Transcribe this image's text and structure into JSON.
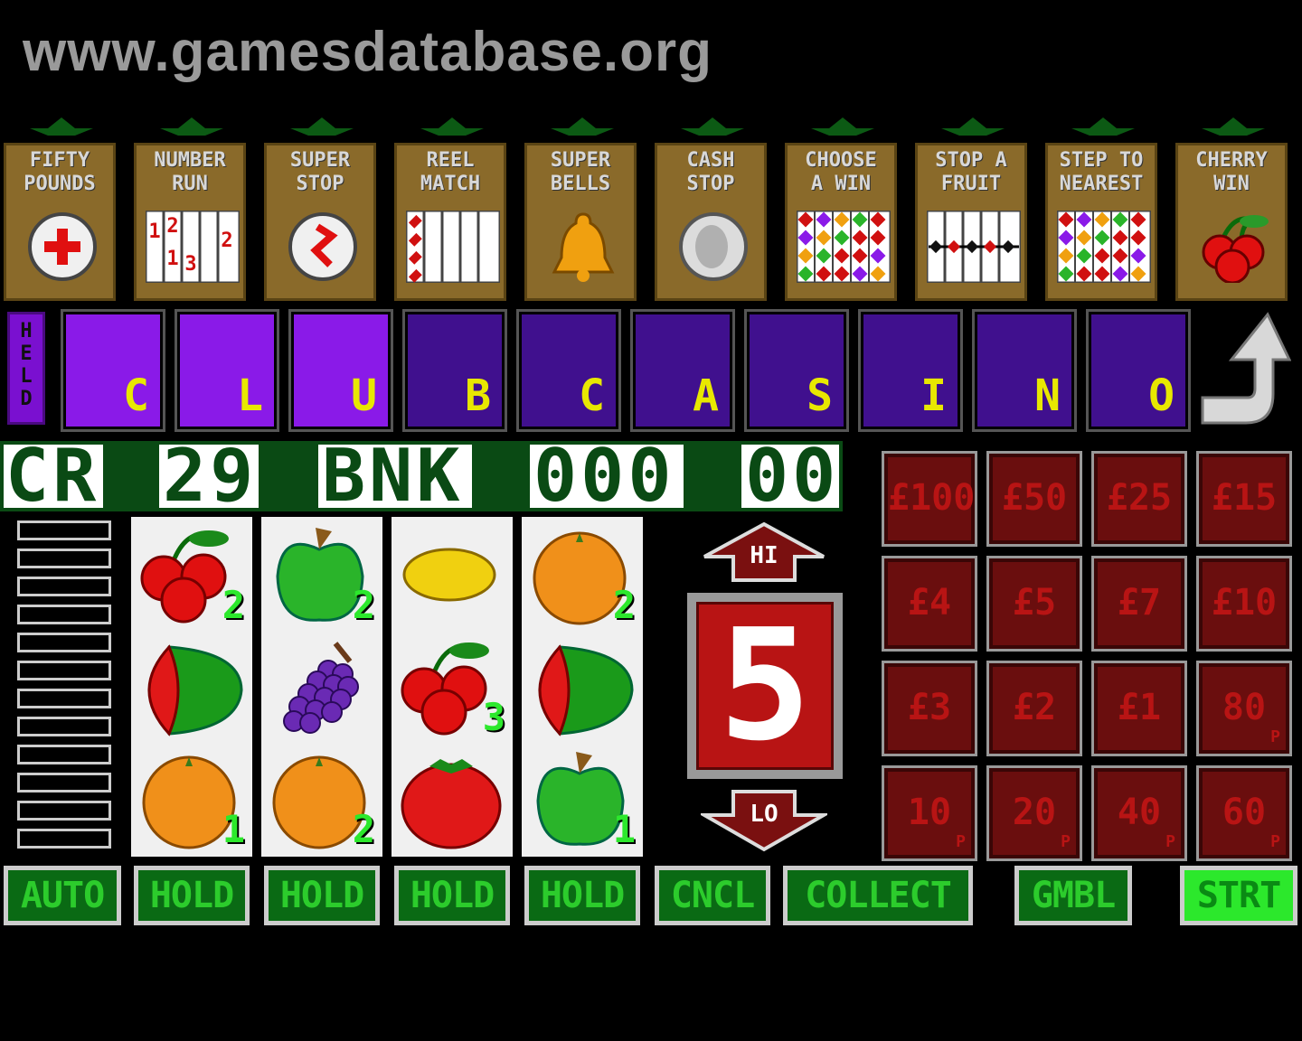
{
  "watermark": "www.gamesdatabase.org",
  "features": [
    {
      "label": "FIFTY\nPOUNDS",
      "icon": "red-cross-coin-icon"
    },
    {
      "label": "NUMBER\nRUN",
      "icon": "number-run-icon"
    },
    {
      "label": "SUPER\nSTOP",
      "icon": "super-stop-coin-icon"
    },
    {
      "label": "REEL\nMATCH",
      "icon": "reel-match-icon"
    },
    {
      "label": "SUPER\nBELLS",
      "icon": "bell-icon"
    },
    {
      "label": "CASH\nSTOP",
      "icon": "silver-coin-icon"
    },
    {
      "label": "CHOOSE\nA WIN",
      "icon": "choose-a-win-icon"
    },
    {
      "label": "STOP A\nFRUIT",
      "icon": "stop-a-fruit-icon"
    },
    {
      "label": "STEP TO\nNEAREST",
      "icon": "step-to-nearest-icon"
    },
    {
      "label": "CHERRY\nWIN",
      "icon": "cherry-icon"
    }
  ],
  "number_run_digits": [
    "1",
    "2",
    "1",
    "3",
    "2"
  ],
  "held_label": "HELD",
  "letters": [
    {
      "ch": "C",
      "lit": true
    },
    {
      "ch": "L",
      "lit": true
    },
    {
      "ch": "U",
      "lit": true
    },
    {
      "ch": "B",
      "lit": false
    },
    {
      "ch": "C",
      "lit": false
    },
    {
      "ch": "A",
      "lit": false
    },
    {
      "ch": "S",
      "lit": false
    },
    {
      "ch": "I",
      "lit": false
    },
    {
      "ch": "N",
      "lit": false
    },
    {
      "ch": "O",
      "lit": false
    }
  ],
  "credit_bar": {
    "cr_label": "CR",
    "credits": "29",
    "bank_label": "BNK",
    "bank": "000",
    "bank2": "00"
  },
  "reels": [
    [
      {
        "fruit": "cherry",
        "n": "2"
      },
      {
        "fruit": "melon",
        "n": ""
      },
      {
        "fruit": "orange",
        "n": "1"
      }
    ],
    [
      {
        "fruit": "apple",
        "n": "2"
      },
      {
        "fruit": "grapes",
        "n": ""
      },
      {
        "fruit": "orange",
        "n": "2"
      }
    ],
    [
      {
        "fruit": "lemon",
        "n": ""
      },
      {
        "fruit": "cherry",
        "n": "3"
      },
      {
        "fruit": "tomato",
        "n": ""
      }
    ],
    [
      {
        "fruit": "orange",
        "n": "2"
      },
      {
        "fruit": "melon",
        "n": ""
      },
      {
        "fruit": "apple",
        "n": "1"
      }
    ]
  ],
  "gamble": {
    "hi": "HI",
    "lo": "LO",
    "value": "5"
  },
  "prizes": [
    {
      "v": "£100",
      "p": ""
    },
    {
      "v": "£50",
      "p": ""
    },
    {
      "v": "£25",
      "p": ""
    },
    {
      "v": "£15",
      "p": ""
    },
    {
      "v": "£4",
      "p": ""
    },
    {
      "v": "£5",
      "p": ""
    },
    {
      "v": "£7",
      "p": ""
    },
    {
      "v": "£10",
      "p": ""
    },
    {
      "v": "£3",
      "p": ""
    },
    {
      "v": "£2",
      "p": ""
    },
    {
      "v": "£1",
      "p": ""
    },
    {
      "v": "80",
      "p": "P"
    },
    {
      "v": "10",
      "p": "P"
    },
    {
      "v": "20",
      "p": "P"
    },
    {
      "v": "40",
      "p": "P"
    },
    {
      "v": "60",
      "p": "P"
    }
  ],
  "buttons": {
    "auto": "AUTO",
    "hold1": "HOLD",
    "hold2": "HOLD",
    "hold3": "HOLD",
    "hold4": "HOLD",
    "cancel": "CNCL",
    "collect": "COLLECT",
    "gamble": "GMBL",
    "start": "STRT"
  },
  "colors": {
    "panel_gold": "#8a6a2a",
    "lit_purple": "#8a1ae8",
    "unlit_purple": "#40108e",
    "letter_yellow": "#e8e800",
    "prize_red": "#6a0e0e",
    "button_green": "#0a6a14"
  }
}
